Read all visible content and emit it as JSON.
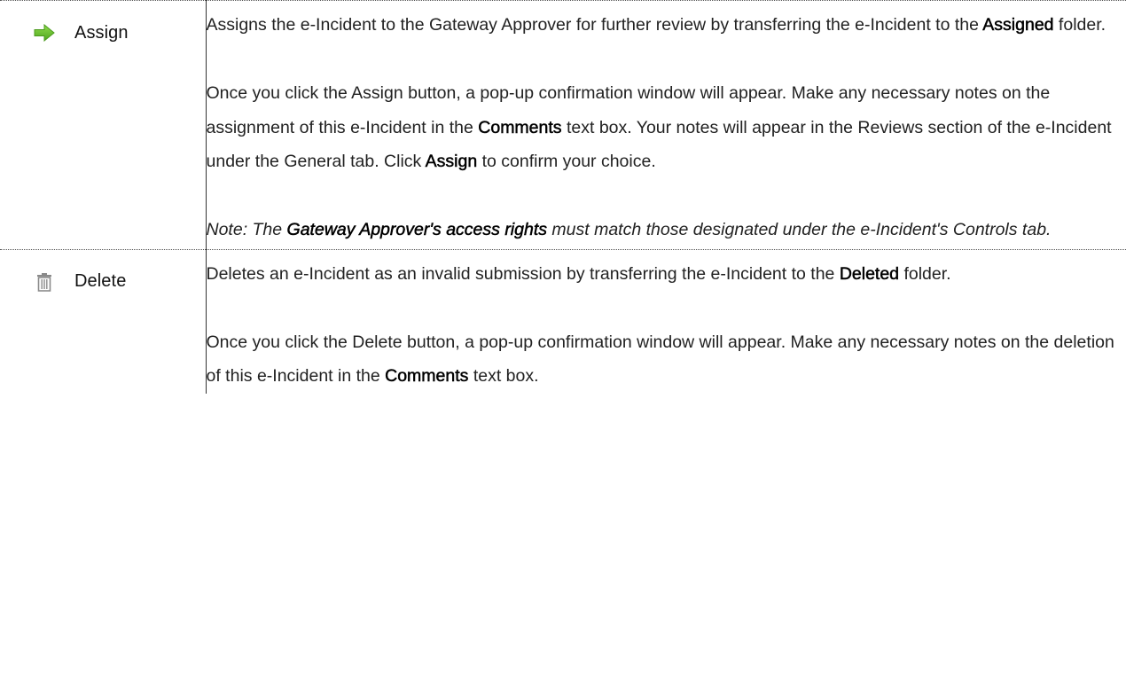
{
  "rows": [
    {
      "command": "Assign",
      "icon": "green-right-arrow-icon",
      "icon_color": "#5cb82a",
      "para1": {
        "a": "Assigns the e-Incident to the Gateway Approver for further review by transferring the e-Incident to the ",
        "b": "Assigned",
        "c": " folder."
      },
      "para2": {
        "a": "Once you click the Assign button, a pop-up confirmation window will appear. Make any necessary notes on the assignment of this e-Incident in the ",
        "b": "Comments",
        "c": " text box. Your notes will appear in the Reviews section of the e-Incident under the General tab. Click ",
        "d": "Assign",
        "e": " to confirm your choice."
      },
      "note": {
        "a": "Note: The ",
        "b": "Gateway Approver's access rights",
        "c": " must match those designated under the e-Incident's Controls tab."
      }
    },
    {
      "command": "Delete",
      "icon": "trash-can-icon",
      "icon_color": "#8a8a8a",
      "para1": {
        "a": "Deletes an e-Incident as an invalid submission by transferring the e-Incident to the ",
        "b": "Deleted",
        "c": " folder."
      },
      "para2": {
        "a": "Once you click the Delete button, a pop-up confirmation window will appear. Make any necessary notes on the deletion of this e-Incident in the ",
        "b": "Comments",
        "c": " text box."
      }
    }
  ]
}
